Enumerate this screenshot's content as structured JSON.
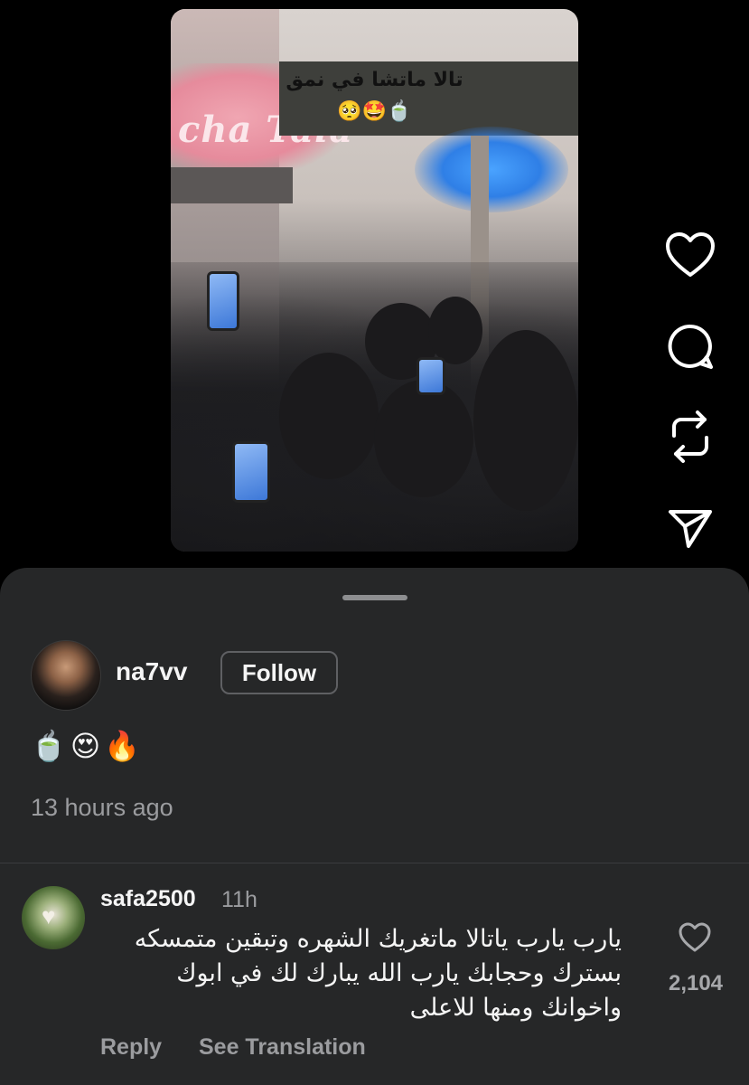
{
  "video": {
    "caption": "تالا ماتشا في نمق",
    "caption_emojis": "🥺🤩🍵",
    "banner_text": "cha Tala"
  },
  "actions": {
    "like_icon": "heart-icon",
    "comment_icon": "comment-icon",
    "repost_icon": "repost-icon",
    "share_icon": "send-icon"
  },
  "post": {
    "username": "na7vv",
    "follow_label": "Follow",
    "emojis": "🍵😍🔥",
    "time_ago": "13 hours ago"
  },
  "comment": {
    "username": "safa2500",
    "time": "11h",
    "text": "يارب يارب ياتالا ماتغريك الشهره وتبقين متمسكه بسترك وحجابك يارب الله يبارك لك في ابوك واخوانك ومنها للاعلى",
    "like_count": "2,104",
    "reply_label": "Reply",
    "translate_label": "See Translation"
  },
  "colors": {
    "background": "#000000",
    "sheet": "#262728",
    "secondary_text": "#9b9c9f"
  }
}
